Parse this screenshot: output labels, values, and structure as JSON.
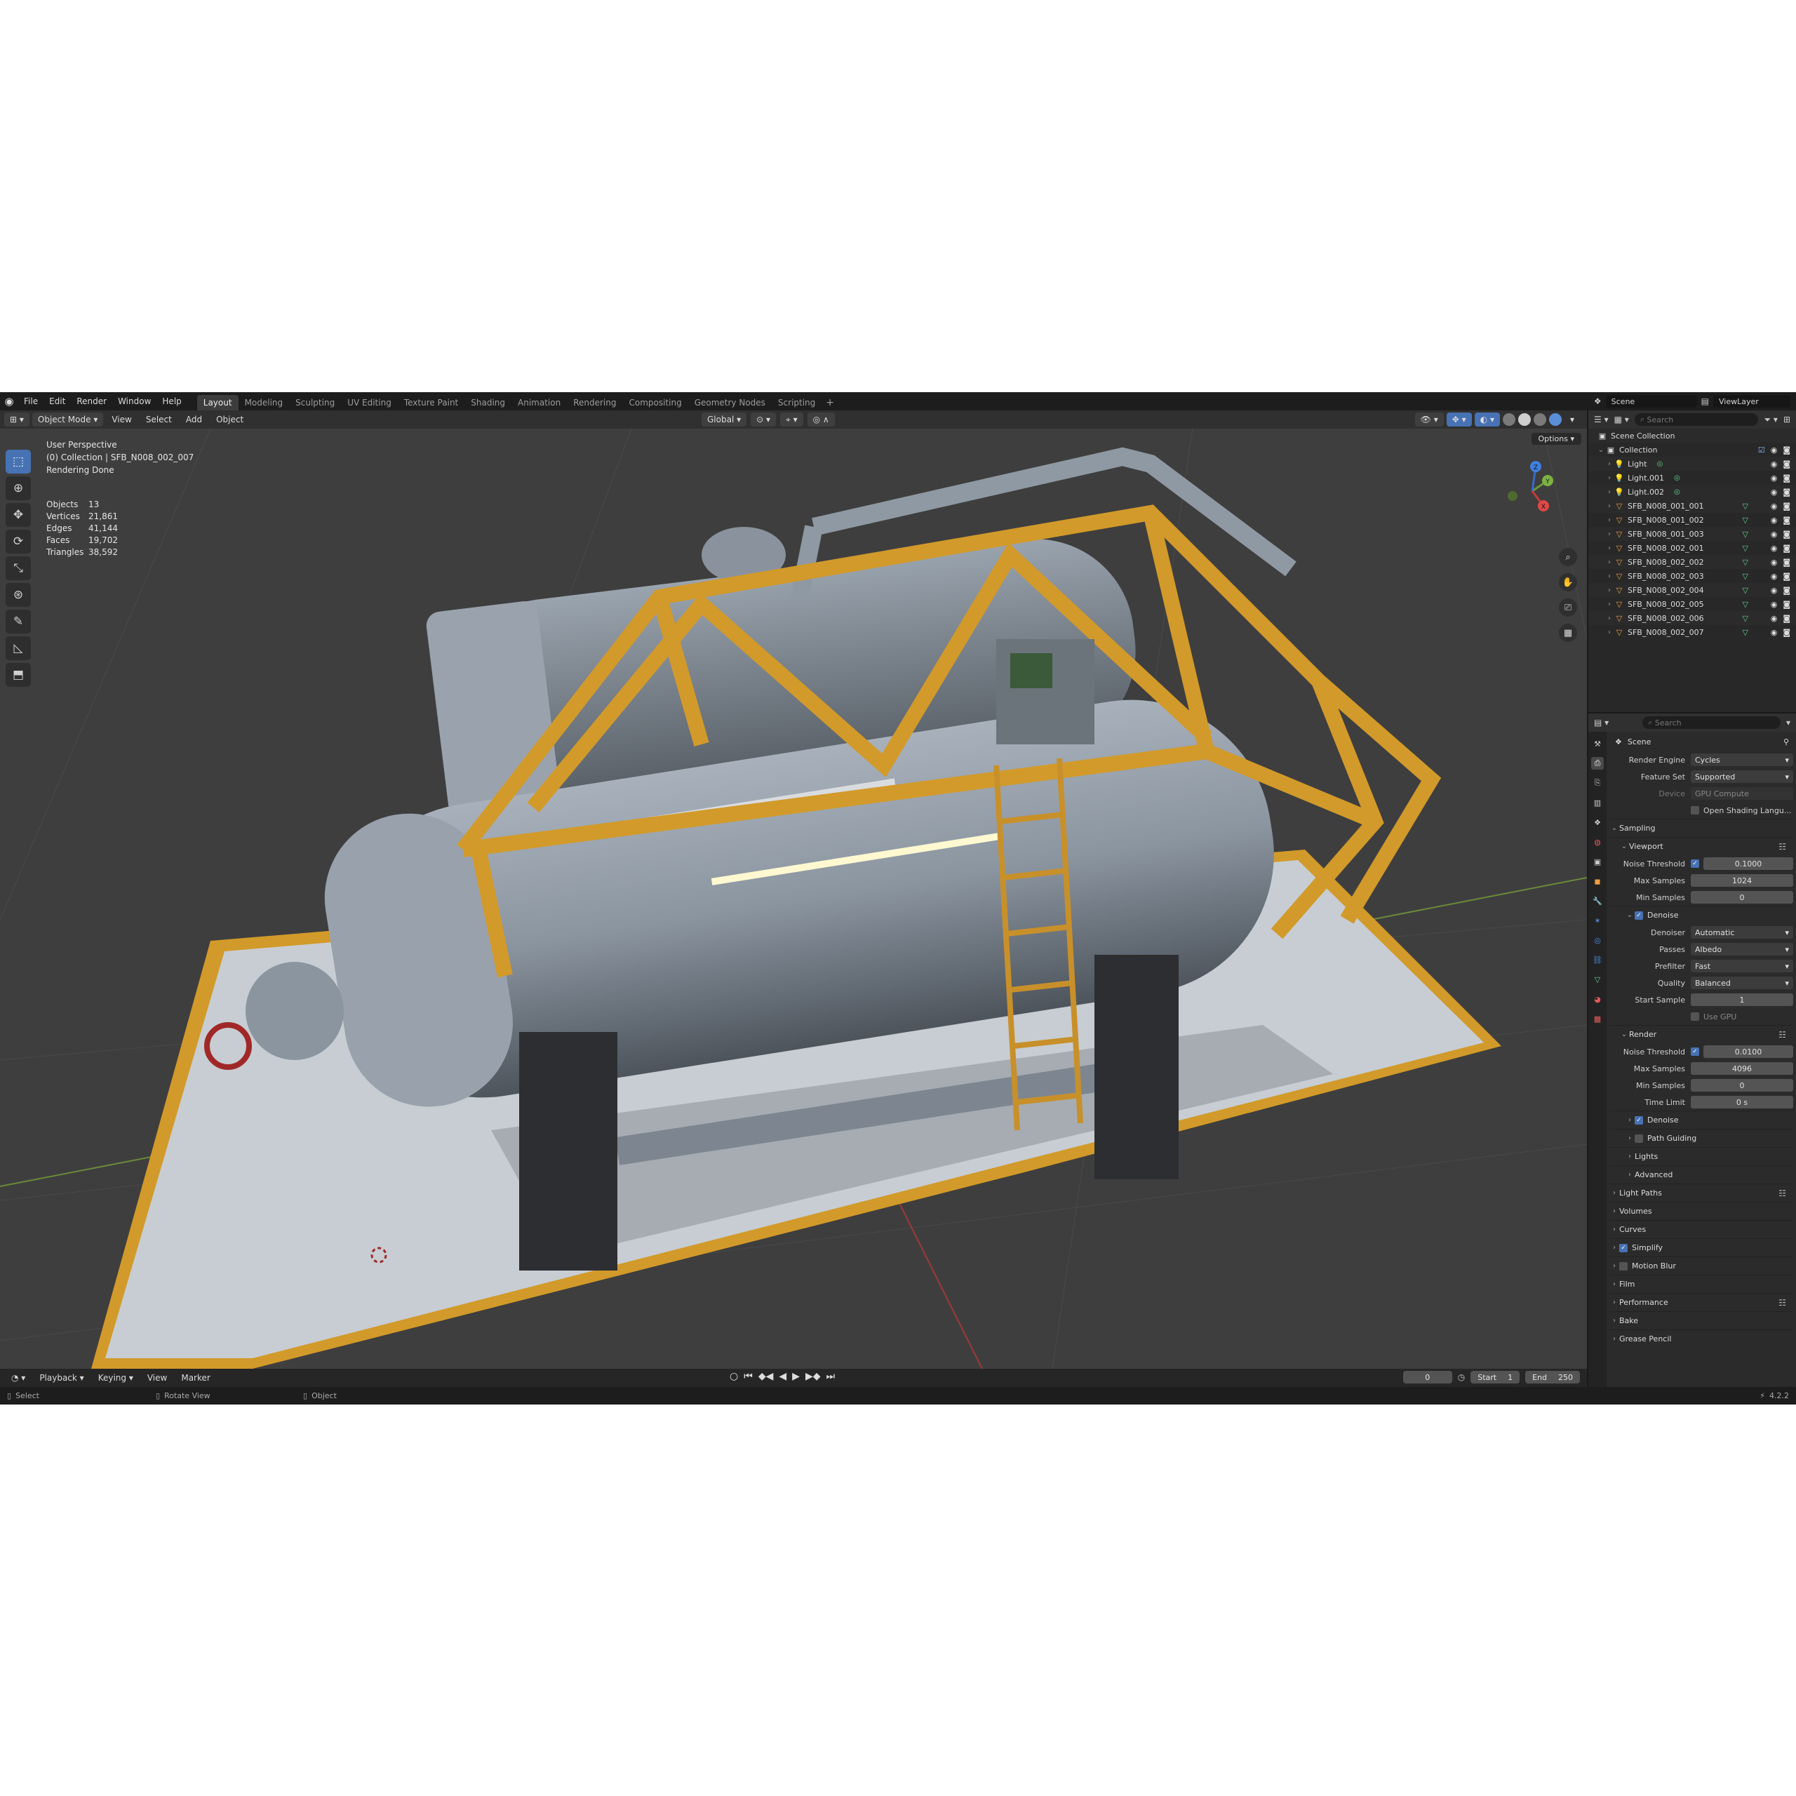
{
  "topbar": {
    "menus": [
      "File",
      "Edit",
      "Render",
      "Window",
      "Help"
    ],
    "workspaces": [
      "Layout",
      "Modeling",
      "Sculpting",
      "UV Editing",
      "Texture Paint",
      "Shading",
      "Animation",
      "Rendering",
      "Compositing",
      "Geometry Nodes",
      "Scripting"
    ],
    "active_workspace": "Layout",
    "add_tab": "+",
    "scene": "Scene",
    "view_layer": "ViewLayer"
  },
  "vp_header": {
    "mode": "Object Mode",
    "menus": [
      "View",
      "Select",
      "Add",
      "Object"
    ],
    "orientation": "Global",
    "options": "Options"
  },
  "viewport": {
    "overlay": {
      "perspective": "User Perspective",
      "collection": "(0) Collection | SFB_N008_002_007",
      "status": "Rendering Done"
    },
    "stats": [
      {
        "k": "Objects",
        "v": "13"
      },
      {
        "k": "Vertices",
        "v": "21,861"
      },
      {
        "k": "Edges",
        "v": "41,144"
      },
      {
        "k": "Faces",
        "v": "19,702"
      },
      {
        "k": "Triangles",
        "v": "38,592"
      }
    ],
    "gizmo": {
      "x": "X",
      "y": "Y",
      "z": "Z"
    }
  },
  "timeline": {
    "menus": [
      "Playback",
      "Keying",
      "View",
      "Marker"
    ],
    "current_frame": "0",
    "start_label": "Start",
    "start": "1",
    "end_label": "End",
    "end": "250"
  },
  "statusbar": {
    "select": "Select",
    "rotate": "Rotate View",
    "object": "Object",
    "version": "4.2.2"
  },
  "outliner": {
    "search_placeholder": "Search",
    "scene_collection": "Scene Collection",
    "collection": "Collection",
    "lights": [
      "Light",
      "Light.001",
      "Light.002"
    ],
    "meshes": [
      "SFB_N008_001_001",
      "SFB_N008_001_002",
      "SFB_N008_001_003",
      "SFB_N008_002_001",
      "SFB_N008_002_002",
      "SFB_N008_002_003",
      "SFB_N008_002_004",
      "SFB_N008_002_005",
      "SFB_N008_002_006",
      "SFB_N008_002_007"
    ]
  },
  "properties": {
    "search_placeholder": "Search",
    "scene": "Scene",
    "render_engine_label": "Render Engine",
    "render_engine": "Cycles",
    "feature_set_label": "Feature Set",
    "feature_set": "Supported",
    "device_label": "Device",
    "device": "GPU Compute",
    "osl": "Open Shading Langu...",
    "sampling": "Sampling",
    "viewport": {
      "title": "Viewport",
      "noise_threshold_label": "Noise Threshold",
      "noise_threshold": "0.1000",
      "max_samples_label": "Max Samples",
      "max_samples": "1024",
      "min_samples_label": "Min Samples",
      "min_samples": "0",
      "denoise": "Denoise",
      "denoiser_label": "Denoiser",
      "denoiser": "Automatic",
      "passes_label": "Passes",
      "passes": "Albedo",
      "prefilter_label": "Prefilter",
      "prefilter": "Fast",
      "quality_label": "Quality",
      "quality": "Balanced",
      "start_sample_label": "Start Sample",
      "start_sample": "1",
      "use_gpu": "Use GPU"
    },
    "render": {
      "title": "Render",
      "noise_threshold_label": "Noise Threshold",
      "noise_threshold": "0.0100",
      "max_samples_label": "Max Samples",
      "max_samples": "4096",
      "min_samples_label": "Min Samples",
      "min_samples": "0",
      "time_limit_label": "Time Limit",
      "time_limit": "0 s",
      "denoise": "Denoise",
      "path_guiding": "Path Guiding",
      "lights": "Lights",
      "advanced": "Advanced"
    },
    "sections": [
      "Light Paths",
      "Volumes",
      "Curves",
      "Simplify",
      "Motion Blur",
      "Film",
      "Performance",
      "Bake",
      "Grease Pencil"
    ]
  },
  "colors": {
    "accent": "#4772b3",
    "frame_yellow": "#d29a2a",
    "tank_grey": "#8b95a0",
    "base_plate": "#c7cdd2"
  }
}
